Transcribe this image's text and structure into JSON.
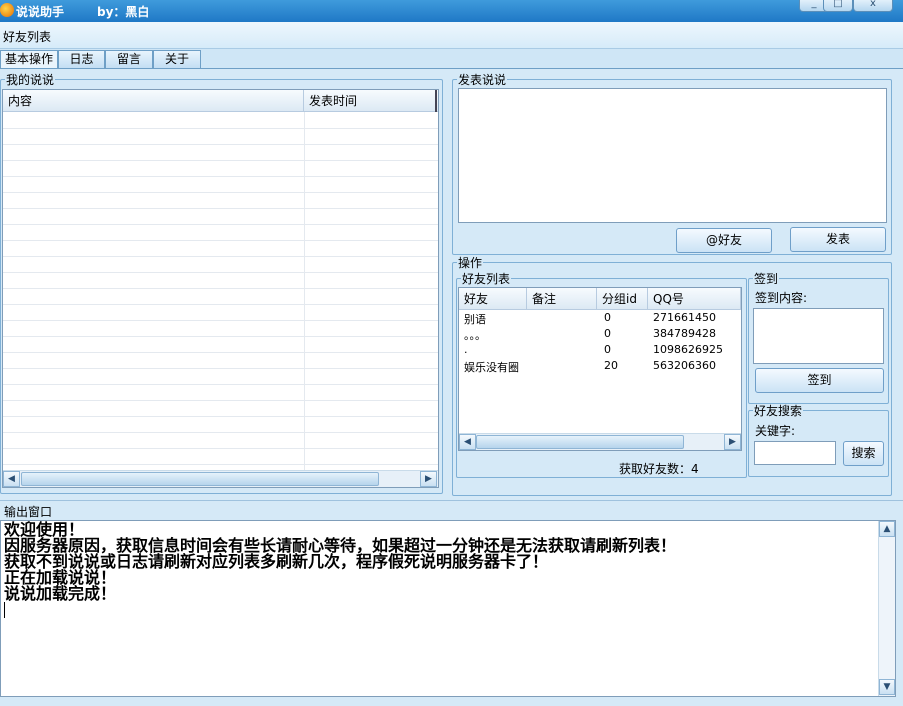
{
  "window": {
    "title": "说说助手",
    "author": "by：黑白",
    "minimize_glyph": "_",
    "maximize_glyph": "□",
    "close_glyph": "x"
  },
  "menu": {
    "item": "好友列表"
  },
  "tabs": [
    {
      "label": "基本操作"
    },
    {
      "label": "日志"
    },
    {
      "label": "留言"
    },
    {
      "label": "关于"
    }
  ],
  "my_posts": {
    "group_title": "我的说说",
    "columns": [
      "内容",
      "发表时间"
    ]
  },
  "publish": {
    "group_title": "发表说说",
    "at_button": "@好友",
    "post_button": "发表"
  },
  "operations": {
    "group_title": "操作",
    "friends": {
      "group_title": "好友列表",
      "columns": [
        "好友",
        "备注",
        "分组id",
        "QQ号"
      ],
      "rows": [
        {
          "name": "别语",
          "remark": "",
          "group": "0",
          "qq": "271661450"
        },
        {
          "name": "。。。",
          "remark": "",
          "group": "0",
          "qq": "384789428"
        },
        {
          "name": ".",
          "remark": "",
          "group": "0",
          "qq": "1098626925"
        },
        {
          "name": "娱乐没有圈",
          "remark": "",
          "group": "20",
          "qq": "563206360"
        }
      ],
      "count_label": "获取好友数：4"
    },
    "checkin": {
      "group_title": "签到",
      "content_label": "签到内容:",
      "button": "签到"
    },
    "search": {
      "group_title": "好友搜索",
      "keyword_label": "关键字:",
      "button": "搜索"
    }
  },
  "output": {
    "group_title": "输出窗口",
    "lines": [
      "欢迎使用！",
      "因服务器原因，获取信息时间会有些长请耐心等待，如果超过一分钟还是无法获取请刷新列表！",
      "获取不到说说或日志请刷新对应列表多刷新几次，程序假死说明服务器卡了！",
      "正在加载说说！",
      "说说加载完成！"
    ]
  }
}
